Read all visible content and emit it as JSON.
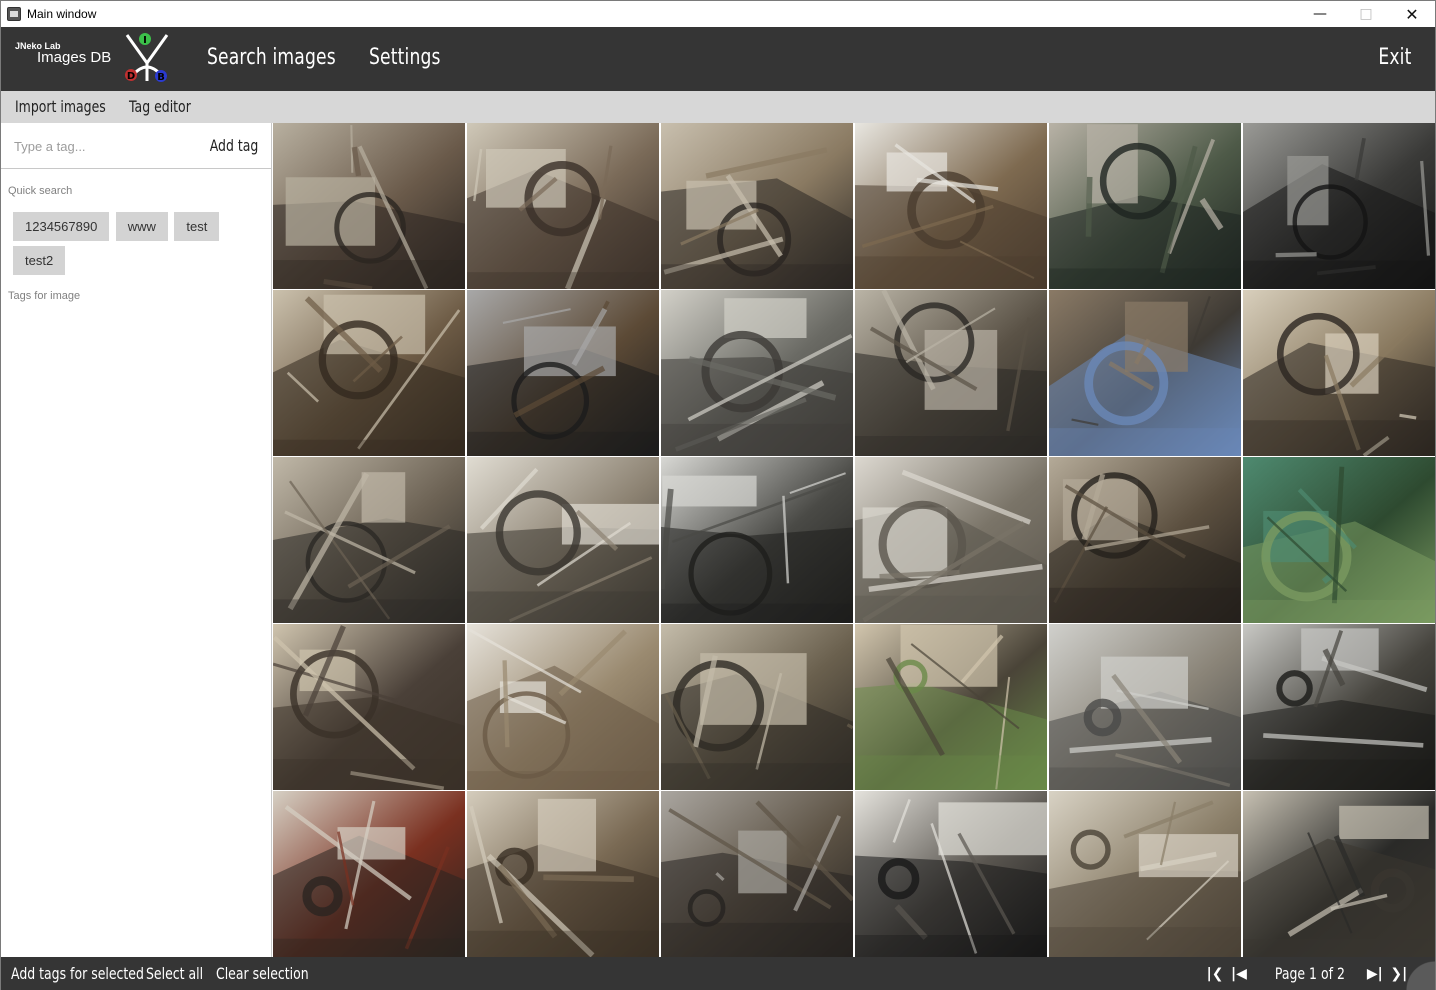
{
  "window": {
    "title": "Main window"
  },
  "header": {
    "logo_small": "JNeko Lab",
    "logo_big": "Images DB",
    "logo_letters": [
      "I",
      "D",
      "B"
    ],
    "nav": {
      "search": "Search images",
      "settings": "Settings",
      "exit": "Exit"
    }
  },
  "subbar": {
    "import": "Import images",
    "tag_editor": "Tag editor"
  },
  "sidebar": {
    "tag_input_placeholder": "Type a tag...",
    "add_tag": "Add tag",
    "quick_search_label": "Quick search",
    "quick_tags": [
      "1234567890",
      "www",
      "test",
      "test2"
    ],
    "tags_for_image_label": "Tags for image"
  },
  "gallery": {
    "columns": 6,
    "rows": 5,
    "thumbnails": [
      {
        "subject": "car interior steering wheel",
        "palette": [
          "#2b2520",
          "#b8b0a0",
          "#6a5a4a"
        ]
      },
      {
        "subject": "car interior seat",
        "palette": [
          "#3a3028",
          "#cfc8b8",
          "#7a6a58"
        ]
      },
      {
        "subject": "car door open insulation",
        "palette": [
          "#2a2622",
          "#c8bfae",
          "#8a7a62"
        ]
      },
      {
        "subject": "white door panel",
        "palette": [
          "#4a3c2e",
          "#e8e6e0",
          "#7e6a50"
        ]
      },
      {
        "subject": "dashboard wiring",
        "palette": [
          "#1e2420",
          "#b8b2a6",
          "#4e5a48"
        ]
      },
      {
        "subject": "instrument cluster",
        "palette": [
          "#141414",
          "#9a9a96",
          "#3a3a38"
        ]
      },
      {
        "subject": "car interior floor",
        "palette": [
          "#33291f",
          "#cbc1ad",
          "#6e5c46"
        ]
      },
      {
        "subject": "dashboard wires foil",
        "palette": [
          "#1c1c1c",
          "#a8a8a8",
          "#5c4a36"
        ]
      },
      {
        "subject": "engine bay firewall",
        "palette": [
          "#3c3a36",
          "#d2d0c8",
          "#6a6a64"
        ]
      },
      {
        "subject": "engine block",
        "palette": [
          "#2a2824",
          "#bab4a6",
          "#5a5246"
        ]
      },
      {
        "subject": "brown sedan outdoors",
        "palette": [
          "#6a88b8",
          "#8a7a66",
          "#3e3a34"
        ]
      },
      {
        "subject": "car interior insulation",
        "palette": [
          "#2c2620",
          "#d8cfbc",
          "#8a7a60"
        ]
      },
      {
        "subject": "dashboard from rear",
        "palette": [
          "#2a2824",
          "#c0b8a8",
          "#6c6254"
        ]
      },
      {
        "subject": "door pillar",
        "palette": [
          "#3a3630",
          "#e0dcd2",
          "#8c8272"
        ]
      },
      {
        "subject": "steering wheel dashboard",
        "palette": [
          "#1e1e1c",
          "#d8d8d4",
          "#4a4a46"
        ]
      },
      {
        "subject": "window frame interior",
        "palette": [
          "#5a554c",
          "#dcd8d0",
          "#7a7468"
        ]
      },
      {
        "subject": "dashboard wiring rear view",
        "palette": [
          "#24201c",
          "#b4aa98",
          "#5c5040"
        ]
      },
      {
        "subject": "green car in grass",
        "palette": [
          "#7a9a60",
          "#4e8a70",
          "#2e4a30"
        ]
      },
      {
        "subject": "rear seats",
        "palette": [
          "#3a3128",
          "#cfc4ae",
          "#4a4038"
        ]
      },
      {
        "subject": "white seat interior",
        "palette": [
          "#6a5a46",
          "#e6e2da",
          "#9a8a70"
        ]
      },
      {
        "subject": "interior front view",
        "palette": [
          "#2e2a24",
          "#c4bcaa",
          "#6a604e"
        ]
      },
      {
        "subject": "beige sedan front",
        "palette": [
          "#6a8a48",
          "#d2c6ae",
          "#4a4438"
        ]
      },
      {
        "subject": "chrome grille headlight",
        "palette": [
          "#4a4a48",
          "#d0d0cc",
          "#8a8478"
        ]
      },
      {
        "subject": "steering wheel close",
        "palette": [
          "#1a1a18",
          "#c8c8c4",
          "#46443e"
        ]
      },
      {
        "subject": "beige sedan rear garage",
        "palette": [
          "#2a2420",
          "#d6d0c4",
          "#7a3020"
        ]
      },
      {
        "subject": "door interior panel",
        "palette": [
          "#3a3024",
          "#d4ccbc",
          "#7a6a54"
        ]
      },
      {
        "subject": "floor wiring foil",
        "palette": [
          "#262320",
          "#aaa6a0",
          "#5e5446"
        ]
      },
      {
        "subject": "dashboard black panel",
        "palette": [
          "#181818",
          "#e4e2dc",
          "#5a5650"
        ]
      },
      {
        "subject": "door frame pillar",
        "palette": [
          "#4a4236",
          "#d8d2c4",
          "#8a7e68"
        ]
      },
      {
        "subject": "engine bay top",
        "palette": [
          "#3a3630",
          "#c6c0b2",
          "#2a2a28"
        ]
      }
    ]
  },
  "footer": {
    "add_tags_for_selected": "Add tags for selected",
    "select_all": "Select all",
    "clear_selection": "Clear selection",
    "page_text": "Page 1 of 2",
    "current_page": 1,
    "total_pages": 2,
    "icons": [
      "first-page-icon",
      "prev-page-icon",
      "next-page-icon",
      "last-page-icon"
    ]
  }
}
